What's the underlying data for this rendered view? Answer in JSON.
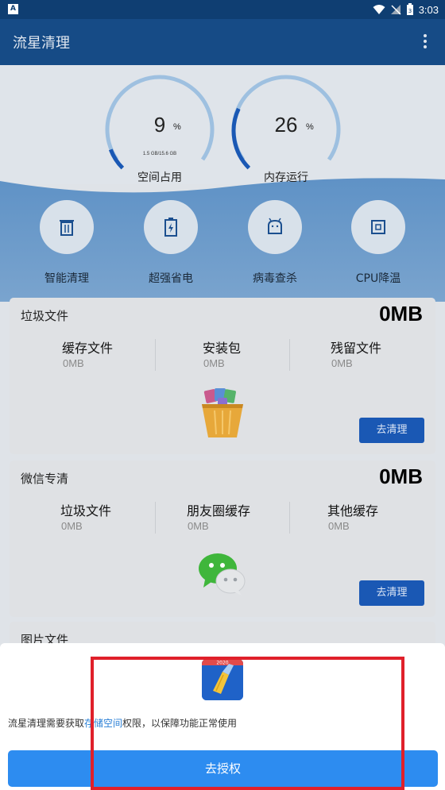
{
  "status_bar": {
    "time": "3:03",
    "notification_letter": "A",
    "battery_level": "3"
  },
  "app": {
    "title": "流星清理"
  },
  "gauges": [
    {
      "value": "9",
      "unit": "%",
      "sub": "1.5 GB/15.6 GB",
      "label": "空间占用",
      "fraction": 0.09
    },
    {
      "value": "26",
      "unit": "%",
      "sub": "",
      "label": "内存运行",
      "fraction": 0.26
    }
  ],
  "features": [
    {
      "label": "智能清理",
      "icon": "trash-icon"
    },
    {
      "label": "超强省电",
      "icon": "battery-icon"
    },
    {
      "label": "病毒查杀",
      "icon": "android-icon"
    },
    {
      "label": "CPU降温",
      "icon": "cpu-icon"
    }
  ],
  "junk_card": {
    "title": "垃圾文件",
    "total": "0MB",
    "columns": [
      {
        "name": "缓存文件",
        "value": "0MB"
      },
      {
        "name": "安装包",
        "value": "0MB"
      },
      {
        "name": "残留文件",
        "value": "0MB"
      }
    ],
    "button": "去清理"
  },
  "wechat_card": {
    "title": "微信专清",
    "total": "0MB",
    "columns": [
      {
        "name": "垃圾文件",
        "value": "0MB"
      },
      {
        "name": "朋友圈缓存",
        "value": "0MB"
      },
      {
        "name": "其他缓存",
        "value": "0MB"
      }
    ],
    "button": "去清理"
  },
  "image_card": {
    "title": "图片文件"
  },
  "permission_sheet": {
    "message_before": "流星清理需要获取",
    "message_link": "存储空间",
    "message_after": "权限，以保障功能正常使用",
    "icon_badge": "2020",
    "button": "去授权"
  },
  "colors": {
    "app_bar": "#164b86",
    "accent_blue": "#1a58b4",
    "grant_button": "#2d8cf0",
    "highlight_border": "#e0202a"
  }
}
